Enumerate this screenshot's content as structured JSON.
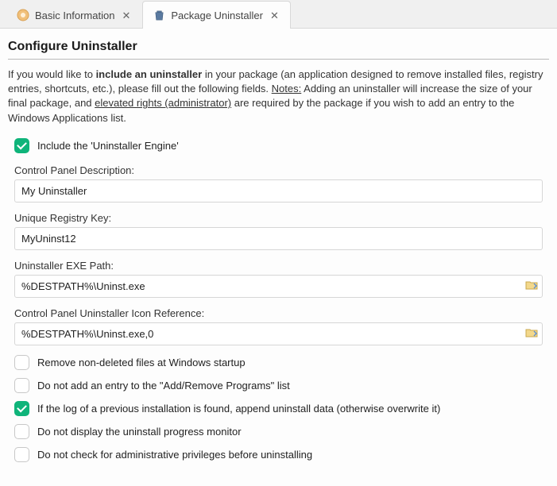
{
  "tabs": [
    {
      "label": "Basic Information",
      "icon": "basic-info-icon"
    },
    {
      "label": "Package Uninstaller",
      "icon": "trash-icon"
    }
  ],
  "activeTab": 1,
  "page": {
    "title": "Configure Uninstaller",
    "desc_prefix": "If you would like to ",
    "desc_bold": "include an uninstaller",
    "desc_mid": " in your package (an application designed to remove installed files, registry entries, shortcuts, etc.), please fill out the following fields. ",
    "desc_notes": "Notes:",
    "desc_after_notes": " Adding an uninstaller will increase the size of your final package, and ",
    "desc_elev": "elevated rights (administrator)",
    "desc_suffix": " are required by the package if you wish to add an entry to the Windows Applications list."
  },
  "includeEngine": {
    "checked": true,
    "label": "Include the 'Uninstaller Engine'"
  },
  "fields": {
    "cpDesc": {
      "label": "Control Panel Description:",
      "value": "My Uninstaller"
    },
    "regKey": {
      "label": "Unique Registry Key:",
      "value": "MyUninst12"
    },
    "exePath": {
      "label": "Uninstaller EXE Path:",
      "value": "%DESTPATH%\\Uninst.exe"
    },
    "iconRef": {
      "label": "Control Panel Uninstaller Icon Reference:",
      "value": "%DESTPATH%\\Uninst.exe,0"
    }
  },
  "options": [
    {
      "checked": false,
      "label": "Remove non-deleted files at Windows startup"
    },
    {
      "checked": false,
      "label": "Do not add an entry to the \"Add/Remove Programs\" list"
    },
    {
      "checked": true,
      "label": "If the log of a previous installation is found, append uninstall data (otherwise overwrite it)"
    },
    {
      "checked": false,
      "label": "Do not display the uninstall progress monitor"
    },
    {
      "checked": false,
      "label": "Do not check for administrative privileges before uninstalling"
    }
  ]
}
